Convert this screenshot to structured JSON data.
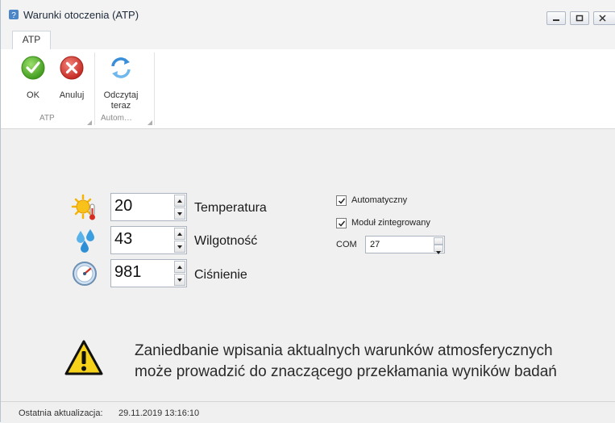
{
  "window": {
    "title": "Warunki otoczenia (ATP)",
    "controls": {
      "minimize": "minimize",
      "maximize": "maximize",
      "close": "close"
    }
  },
  "tabs": [
    {
      "label": "ATP",
      "active": true
    }
  ],
  "ribbon": {
    "groups": [
      {
        "label": "ATP",
        "buttons": [
          {
            "label": "OK",
            "icon": "ok-icon"
          },
          {
            "label": "Anuluj",
            "icon": "cancel-icon"
          }
        ]
      },
      {
        "label": "Autom…",
        "buttons": [
          {
            "label_line1": "Odczytaj",
            "label_line2": "teraz",
            "icon": "refresh-icon"
          }
        ]
      }
    ]
  },
  "fields": {
    "temperature": {
      "value": "20",
      "label": "Temperatura",
      "icon": "temperature-sun-icon"
    },
    "humidity": {
      "value": "43",
      "label": "Wilgotność",
      "icon": "water-drops-icon"
    },
    "pressure": {
      "value": "981",
      "label": "Ciśnienie",
      "icon": "pressure-gauge-icon"
    }
  },
  "options": {
    "automatic": {
      "label": "Automatyczny",
      "checked": true
    },
    "integrated_module": {
      "label": "Moduł zintegrowany",
      "checked": true
    },
    "com": {
      "label": "COM",
      "value": "27"
    }
  },
  "warning": {
    "icon": "warning-icon",
    "line1": "Zaniedbanie wpisania aktualnych warunków atmosferycznych",
    "line2": "może prowadzić do znaczącego przekłamania wyników badań"
  },
  "status": {
    "label": "Ostatnia aktualizacja:",
    "value": "29.11.2019 13:16:10"
  },
  "colors": {
    "ok_green": "#5aae2c",
    "cancel_red": "#d8322a",
    "refresh_blue": "#3a8ed8",
    "warning_yellow": "#f7d21a"
  }
}
